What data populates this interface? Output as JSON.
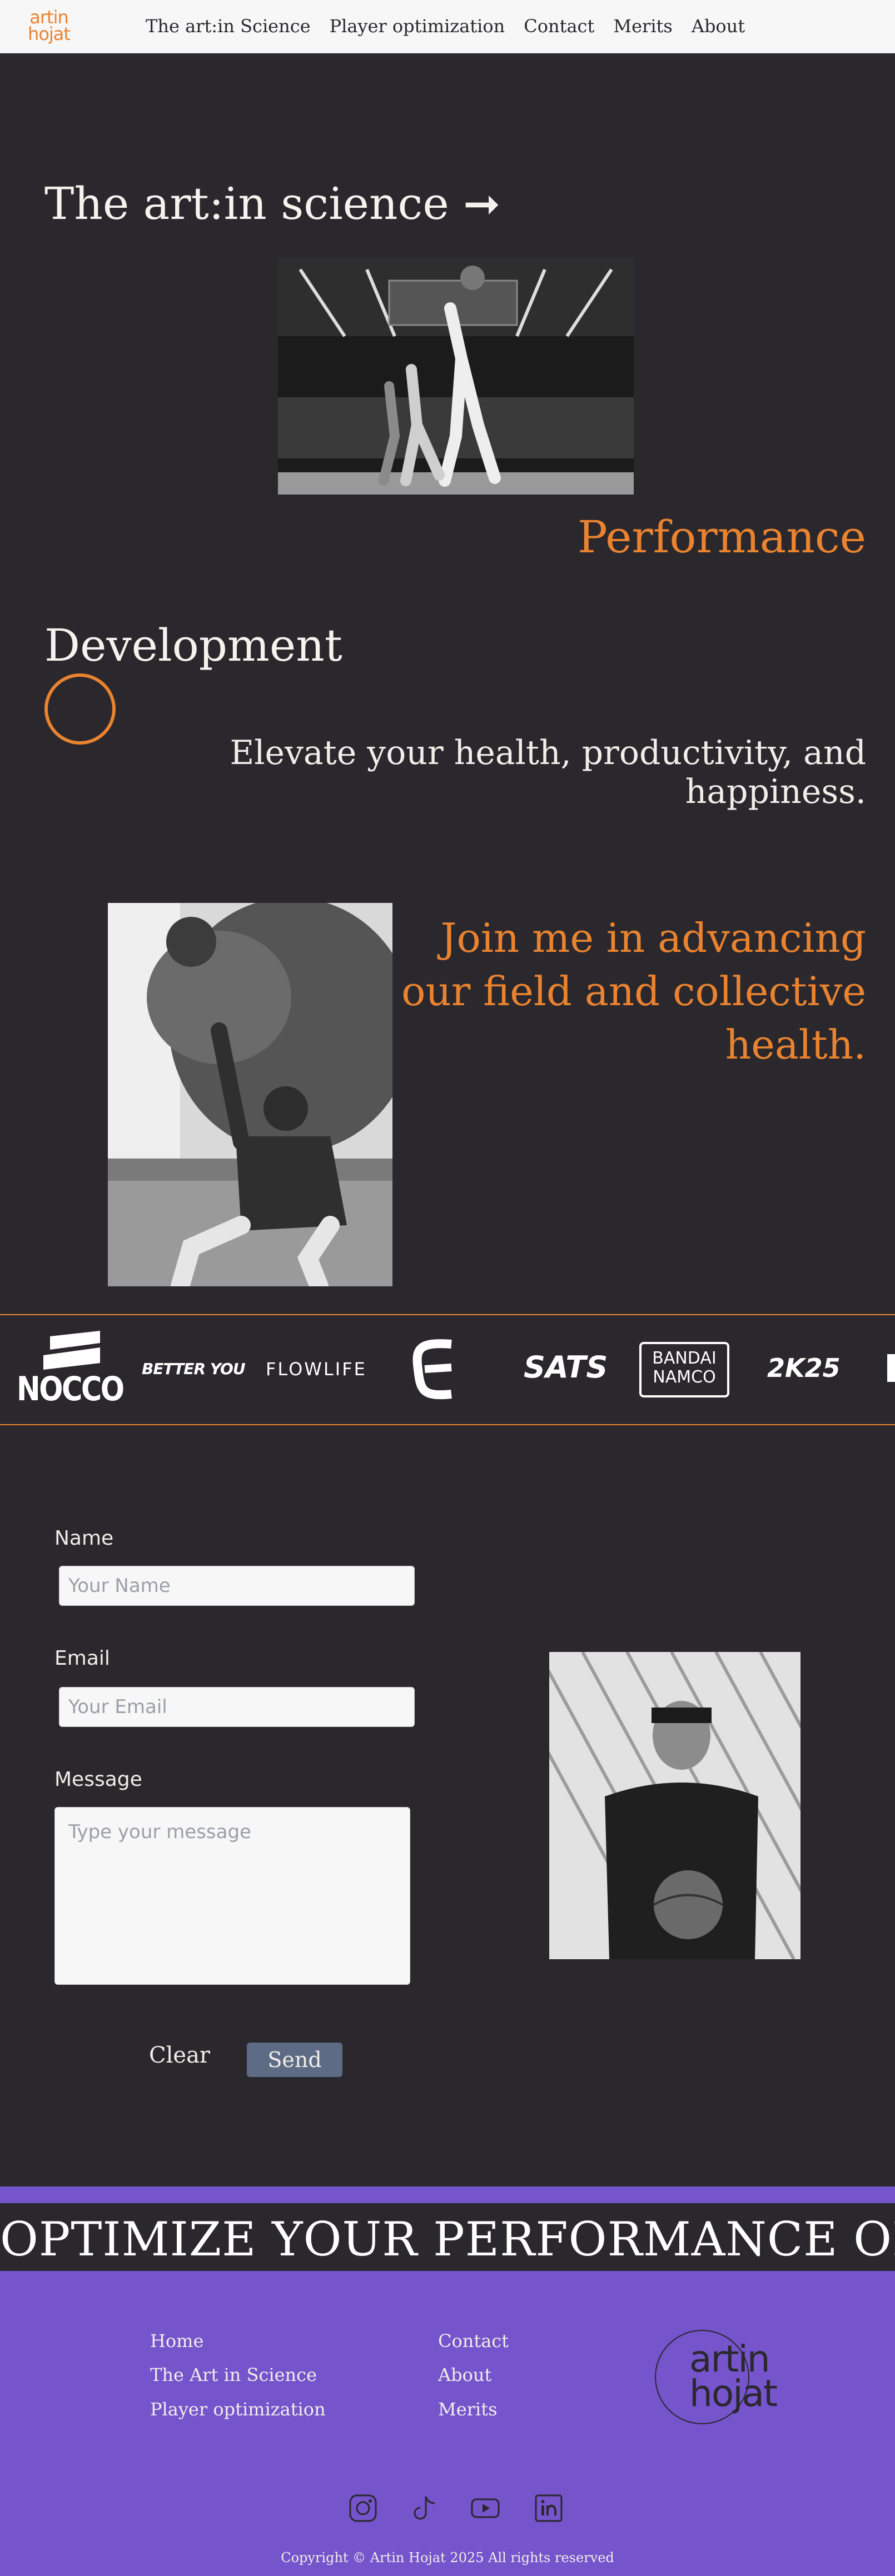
{
  "nav": {
    "logo_line1": "artin",
    "logo_line2": "hojat",
    "links": [
      "The art:in Science",
      "Player optimization",
      "Contact",
      "Merits",
      "About"
    ]
  },
  "hero": {
    "title": "The art:in science",
    "arrow": "➞",
    "performance": "Performance",
    "development": "Development",
    "tagline": "Elevate your health, productivity, and happiness.",
    "join": "Join me in advancing our field and collective health."
  },
  "sponsors": [
    "NOCCO",
    "BETTER YOU",
    "FLOWLIFE",
    "SATS",
    "BANDAI",
    "NAMCO",
    "2K25"
  ],
  "form": {
    "name_label": "Name",
    "name_placeholder": "Your Name",
    "email_label": "Email",
    "email_placeholder": "Your Email",
    "message_label": "Message",
    "message_placeholder": "Type your message",
    "clear_label": "Clear",
    "send_label": "Send"
  },
  "marquee": "OPTIMIZE YOUR PERFORMANCE OPTIMIZE YOUR PERFORMANCE",
  "footer": {
    "col1": [
      "Home",
      "The Art in Science",
      "Player optimization"
    ],
    "col2": [
      "Contact",
      "About",
      "Merits"
    ],
    "logo_line1": "artin",
    "logo_line2": "hojat",
    "social_icons": [
      "instagram-icon",
      "tiktok-icon",
      "youtube-icon",
      "linkedin-icon"
    ],
    "copyright": "Copyright © Artin Hojat 2025 All rights reserved"
  },
  "colors": {
    "accent": "#ea8330",
    "background": "#2a282d",
    "footer": "#7554cc",
    "send_button": "#5d6b84"
  }
}
